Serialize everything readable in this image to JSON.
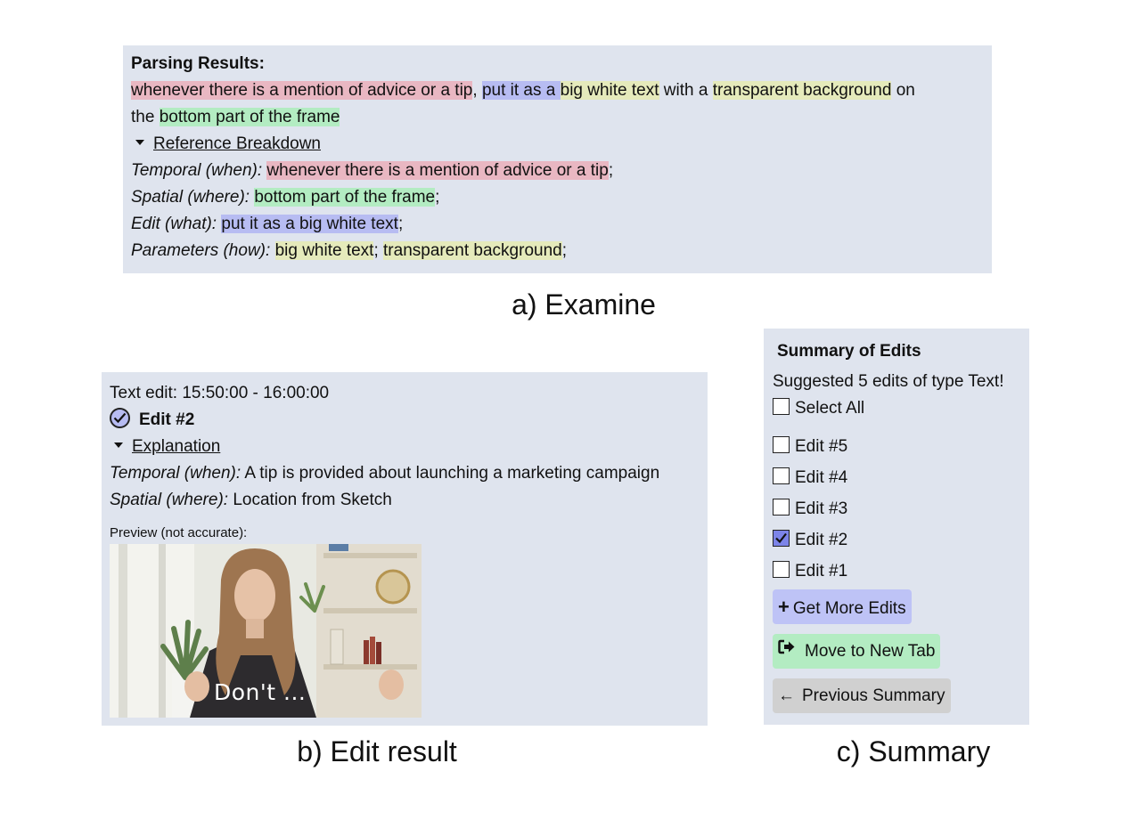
{
  "examine": {
    "title": "Parsing Results:",
    "sentence": {
      "temporal": "whenever there is a mention of advice or a tip",
      "comma": ", ",
      "edit_prefix": "put it as a",
      "space": " ",
      "param1": "big white text",
      "with": " with a ",
      "param2": "transparent background",
      "on": " on",
      "the": "the ",
      "spatial": "bottom part of the frame"
    },
    "breakdown_label": "Reference Breakdown",
    "rows": {
      "temporal_label": "Temporal (when):",
      "temporal_value": "whenever there is a mention of advice or a tip",
      "spatial_label": "Spatial (where):",
      "spatial_value": "bottom part of the frame",
      "edit_label": "Edit (what):",
      "edit_value": "put it as a big white text",
      "params_label": "Parameters (how):",
      "params_value1": "big white text",
      "params_value2": "transparent background",
      "semicolon": ";",
      "semicolon_space": "; "
    },
    "caption": "a) Examine"
  },
  "edit_result": {
    "header": "Text edit: 15:50:00 - 16:00:00",
    "edit_title": "Edit #2",
    "explanation_label": "Explanation",
    "temporal_label": "Temporal (when):",
    "temporal_value": " A tip is provided about launching a marketing campaign",
    "spatial_label": "Spatial (where):",
    "spatial_value": " Location from Sketch",
    "preview_label": "Preview (not accurate):",
    "preview_overlay": "Don't ...",
    "caption": "b) Edit result"
  },
  "summary": {
    "title": "Summary of Edits",
    "suggested": "Suggested 5 edits of type Text!",
    "select_all": "Select All",
    "edits": [
      {
        "label": "Edit #5",
        "checked": false
      },
      {
        "label": "Edit #4",
        "checked": false
      },
      {
        "label": "Edit #3",
        "checked": false
      },
      {
        "label": "Edit #2",
        "checked": true
      },
      {
        "label": "Edit #1",
        "checked": false
      }
    ],
    "get_more": "Get More Edits",
    "move_tab": "Move to New Tab",
    "previous": "Previous Summary",
    "caption": "c) Summary"
  },
  "colors": {
    "panel": "#dfe4ee",
    "temporal": "#e9b7c2",
    "edit": "#b7bcf2",
    "parameters": "#e5eabb",
    "spatial": "#b3ecc2"
  }
}
